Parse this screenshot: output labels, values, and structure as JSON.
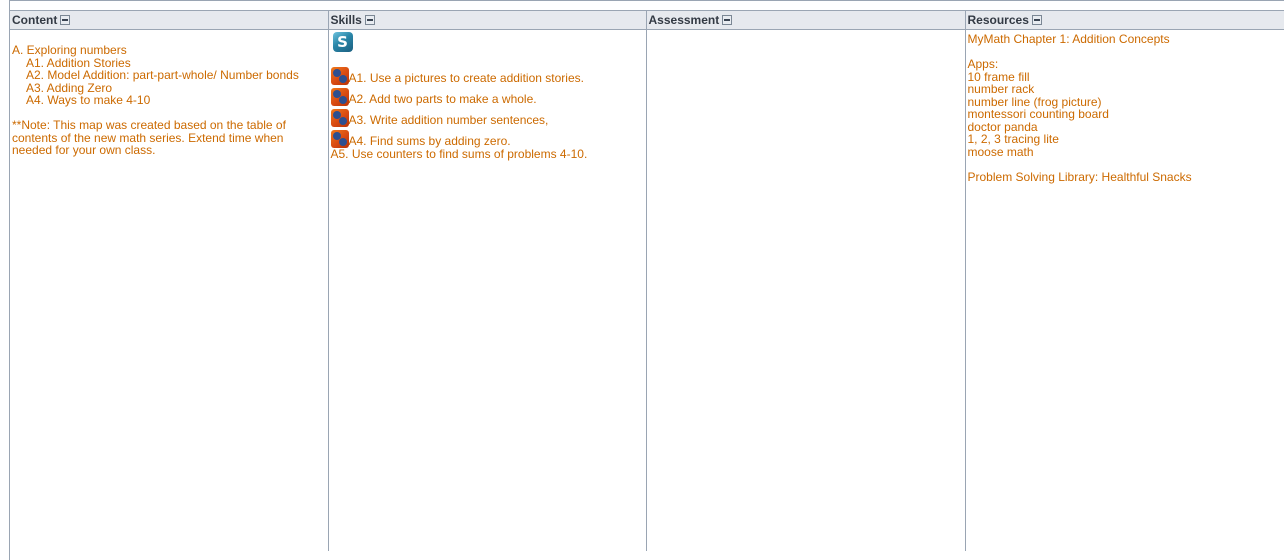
{
  "columns": {
    "content": "Content",
    "skills": "Skills",
    "assessment": "Assessment",
    "resources": "Resources"
  },
  "content": {
    "heading": "A. Exploring numbers",
    "items": [
      "A1. Addition Stories",
      "A2. Model Addition: part-part-whole/ Number bonds",
      "A3. Adding Zero",
      "A4. Ways to make 4-10"
    ],
    "note": "**Note: This map was created  based on the table of contents of the new math series. Extend time when needed for your own class."
  },
  "skills": {
    "top_icon_glyph": "S",
    "items": [
      "A1. Use a pictures to create addition stories.",
      "A2. Add two parts to make a whole.",
      "A3. Write addition number sentences,",
      "A4. Find sums by adding zero."
    ],
    "extra": "A5. Use counters to find sums of problems 4-10."
  },
  "resources": {
    "chapter": "MyMath Chapter 1: Addition Concepts",
    "apps_label": "Apps:",
    "apps": [
      "10 frame fill",
      "number rack",
      "number line (frog picture)",
      "montessori counting board",
      "doctor panda",
      "1, 2, 3 tracing lite",
      "moose math"
    ],
    "library": "Problem Solving Library: Healthful Snacks"
  },
  "colors": {
    "body_text": "#cc6a00",
    "header_bg": "#e6e9ee",
    "border": "#9aa5b3"
  }
}
